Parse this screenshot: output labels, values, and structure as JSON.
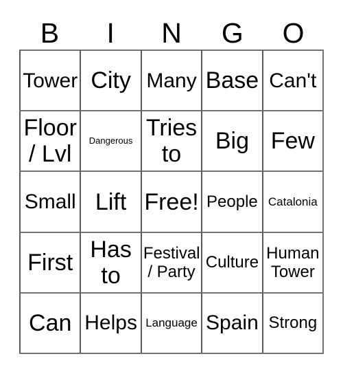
{
  "card": {
    "title": "BINGO",
    "header_letters": [
      "B",
      "I",
      "N",
      "G",
      "O"
    ],
    "columns": 5,
    "rows": 5,
    "free_space_label": "Free!",
    "free_space_position": "center",
    "colors": {
      "background": "#ffffff",
      "text": "#000000",
      "grid_line": "#737373",
      "grid_line_inner": "#5a5a5a"
    },
    "cells": [
      [
        {
          "text": "Tower",
          "size": "lg"
        },
        {
          "text": "City",
          "size": "xl"
        },
        {
          "text": "Many",
          "size": "lg"
        },
        {
          "text": "Base",
          "size": "xl"
        },
        {
          "text": "Can't",
          "size": "lg"
        }
      ],
      [
        {
          "text": "Floor\n/ Lvl",
          "size": "xl"
        },
        {
          "text": "Dangerous",
          "size": "xs"
        },
        {
          "text": "Tries\nto",
          "size": "xl"
        },
        {
          "text": "Big",
          "size": "xl"
        },
        {
          "text": "Few",
          "size": "xl"
        }
      ],
      [
        {
          "text": "Small",
          "size": "lg"
        },
        {
          "text": "Lift",
          "size": "xl"
        },
        {
          "text": "Free!",
          "size": "xl"
        },
        {
          "text": "People",
          "size": "md"
        },
        {
          "text": "Catalonia",
          "size": "sm"
        }
      ],
      [
        {
          "text": "First",
          "size": "xl"
        },
        {
          "text": "Has\nto",
          "size": "xl"
        },
        {
          "text": "Festival\n/ Party",
          "size": "md"
        },
        {
          "text": "Culture",
          "size": "md"
        },
        {
          "text": "Human\nTower",
          "size": "md"
        }
      ],
      [
        {
          "text": "Can",
          "size": "xl"
        },
        {
          "text": "Helps",
          "size": "lg"
        },
        {
          "text": "Language",
          "size": "sm"
        },
        {
          "text": "Spain",
          "size": "lg"
        },
        {
          "text": "Strong",
          "size": "md"
        }
      ]
    ]
  }
}
